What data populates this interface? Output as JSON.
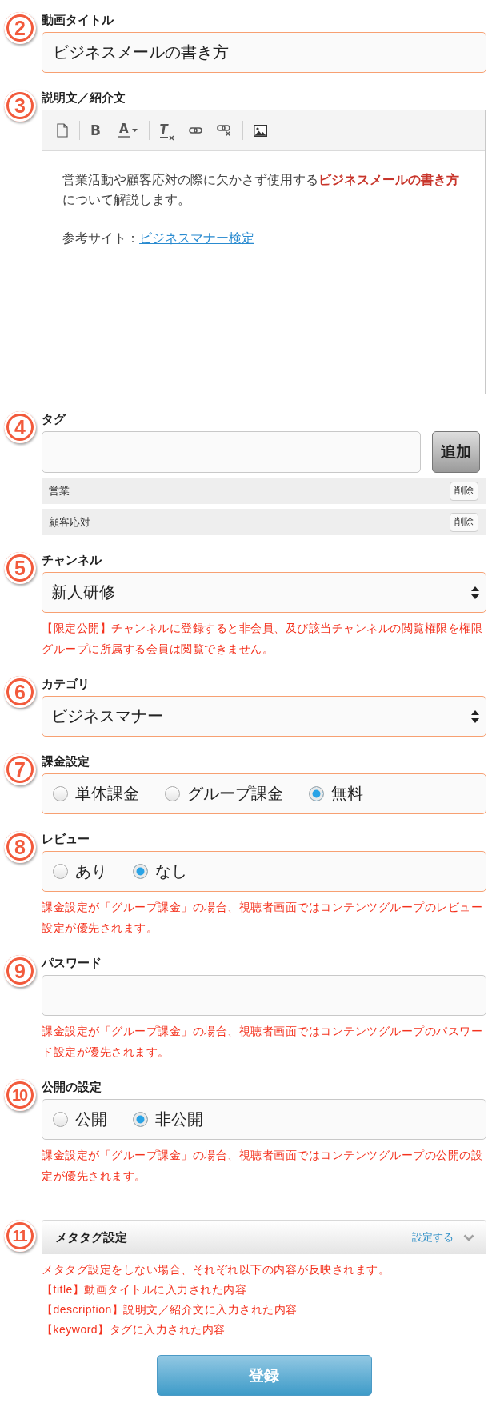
{
  "sections": [
    {
      "step": "2",
      "kind": "text",
      "label": "動画タイトル",
      "highlighted": true,
      "value": "ビジネスメールの書き方"
    },
    {
      "step": "3",
      "kind": "editor",
      "label": "説明文／紹介文",
      "highlighted": false,
      "toolbar": [
        {
          "kind": "document"
        },
        {
          "kind": "separator"
        },
        {
          "kind": "bold",
          "glyph": "B"
        },
        {
          "kind": "text-color",
          "glyph": "A"
        },
        {
          "kind": "separator"
        },
        {
          "kind": "clear-format",
          "glyph": "T"
        },
        {
          "kind": "link"
        },
        {
          "kind": "unlink"
        },
        {
          "kind": "separator"
        },
        {
          "kind": "image"
        }
      ],
      "paragraphs": [
        {
          "text": "営業活動や顧客応対の際に欠かさず使用する**ビジネスメールの書き方**について解説します。"
        },
        {
          "text": "参考サイト：",
          "link": "ビジネスマナー検定"
        }
      ]
    },
    {
      "step": "4",
      "kind": "tags",
      "label": "タグ",
      "highlighted": false,
      "add_button": "追加",
      "tags": [
        {
          "name": "営業",
          "delete_button": "削除"
        },
        {
          "name": "顧客応対",
          "delete_button": "削除"
        }
      ]
    },
    {
      "step": "5",
      "kind": "select",
      "label": "チャンネル",
      "highlighted": true,
      "value": "新人研修",
      "note": "【限定公開】チャンネルに登録すると非会員、及び該当チャンネルの閲覧権限を権限グループに所属する会員は閲覧できません。"
    },
    {
      "step": "6",
      "kind": "select",
      "label": "カテゴリ",
      "highlighted": true,
      "value": "ビジネスマナー"
    },
    {
      "step": "7",
      "kind": "radio",
      "label": "課金設定",
      "highlighted": true,
      "options": [
        {
          "label": "単体課金",
          "selected": false
        },
        {
          "label": "グループ課金",
          "selected": false
        },
        {
          "label": "無料",
          "selected": true
        }
      ]
    },
    {
      "step": "8",
      "kind": "radio",
      "label": "レビュー",
      "highlighted": true,
      "options": [
        {
          "label": "あり",
          "selected": false
        },
        {
          "label": "なし",
          "selected": true
        }
      ],
      "note": "課金設定が「グループ課金」の場合、視聴者画面ではコンテンツグループのレビュー設定が優先されます。"
    },
    {
      "step": "9",
      "kind": "text",
      "label": "パスワード",
      "highlighted": false,
      "note": "課金設定が「グループ課金」の場合、視聴者画面ではコンテンツグループのパスワード設定が優先されます。"
    },
    {
      "step": "10",
      "kind": "radio",
      "label": "公開の設定",
      "highlighted": false,
      "options": [
        {
          "label": "公開",
          "selected": false
        },
        {
          "label": "非公開",
          "selected": true
        }
      ],
      "note": "課金設定が「グループ課金」の場合、視聴者画面ではコンテンツグループの公開の設定が優先されます。"
    },
    {
      "step": "11",
      "kind": "meta",
      "label": "メタタグ設定",
      "link": "設定する",
      "expanded": false,
      "notes": [
        "メタタグ設定をしない場合、それぞれ以下の内容が反映されます。",
        "【title】動画タイトルに入力された内容",
        "【description】説明文／紹介文に入力された内容",
        "【keyword】タグに入力された内容"
      ]
    }
  ],
  "submit_button": "登録"
}
